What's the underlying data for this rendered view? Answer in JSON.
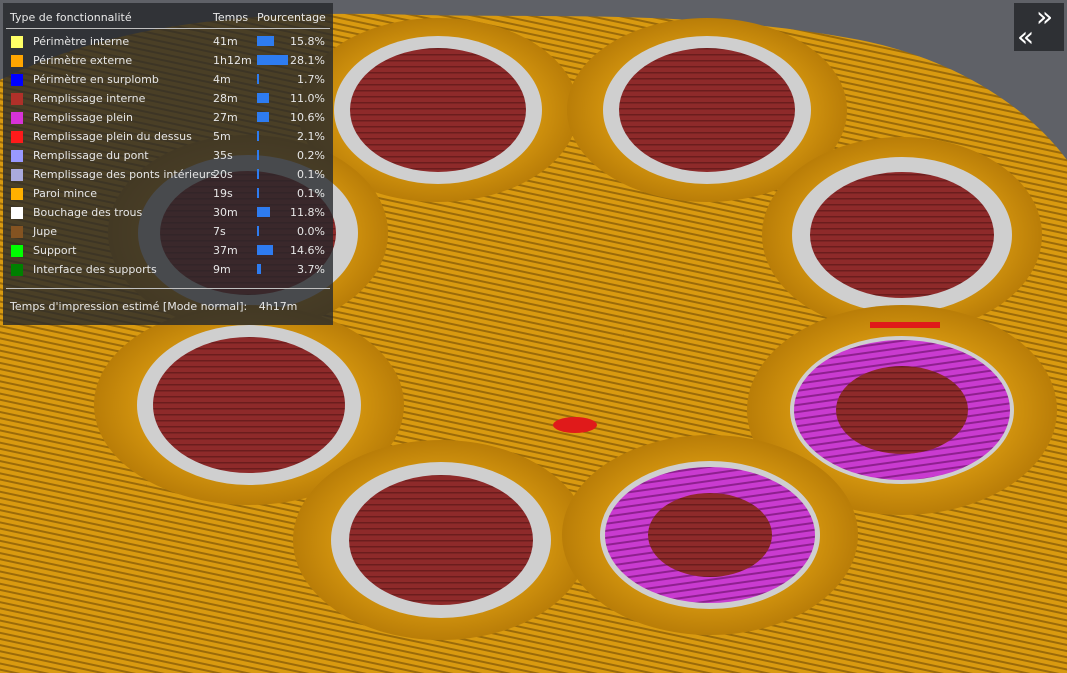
{
  "legend": {
    "headers": {
      "feature": "Type de fonctionnalité",
      "time": "Temps",
      "percent": "Pourcentage"
    },
    "rows": [
      {
        "name": "Périmètre interne",
        "time": "41m",
        "percent": "15.8%",
        "value": 15.8,
        "color": "#ffff66"
      },
      {
        "name": "Périmètre externe",
        "time": "1h12m",
        "percent": "28.1%",
        "value": 28.1,
        "color": "#ffa500"
      },
      {
        "name": "Périmètre en surplomb",
        "time": "4m",
        "percent": "1.7%",
        "value": 1.7,
        "color": "#0000ff"
      },
      {
        "name": "Remplissage interne",
        "time": "28m",
        "percent": "11.0%",
        "value": 11.0,
        "color": "#b03029"
      },
      {
        "name": "Remplissage plein",
        "time": "27m",
        "percent": "10.6%",
        "value": 10.6,
        "color": "#d732d7"
      },
      {
        "name": "Remplissage plein du dessus",
        "time": "5m",
        "percent": "2.1%",
        "value": 2.1,
        "color": "#ff1a1a"
      },
      {
        "name": "Remplissage du pont",
        "time": "35s",
        "percent": "0.2%",
        "value": 0.2,
        "color": "#9999ff"
      },
      {
        "name": "Remplissage des ponts intérieurs",
        "time": "20s",
        "percent": "0.1%",
        "value": 0.1,
        "color": "#aaaadd"
      },
      {
        "name": "Paroi mince",
        "time": "19s",
        "percent": "0.1%",
        "value": 0.1,
        "color": "#ffb000"
      },
      {
        "name": "Bouchage des trous",
        "time": "30m",
        "percent": "11.8%",
        "value": 11.8,
        "color": "#ffffff"
      },
      {
        "name": "Jupe",
        "time": "7s",
        "percent": "0.0%",
        "value": 0.0,
        "color": "#845321"
      },
      {
        "name": "Support",
        "time": "37m",
        "percent": "14.6%",
        "value": 14.6,
        "color": "#00ff00"
      },
      {
        "name": "Interface des supports",
        "time": "9m",
        "percent": "3.7%",
        "value": 3.7,
        "color": "#008000"
      }
    ],
    "estimate_label": "Temps d'impression estimé [Mode normal]:",
    "estimate_value": "4h17m"
  },
  "toolbar": {
    "expand_glyph": "»",
    "collapse_glyph": "«"
  },
  "colors": {
    "perimeter_orange": "#e3a10a",
    "infill_dark_red": "#8e2a2a",
    "solid_infill_purple": "#c93bd0",
    "outer_perimeter_white": "#e0e0e0",
    "bar_blue": "#2e7cf0"
  }
}
